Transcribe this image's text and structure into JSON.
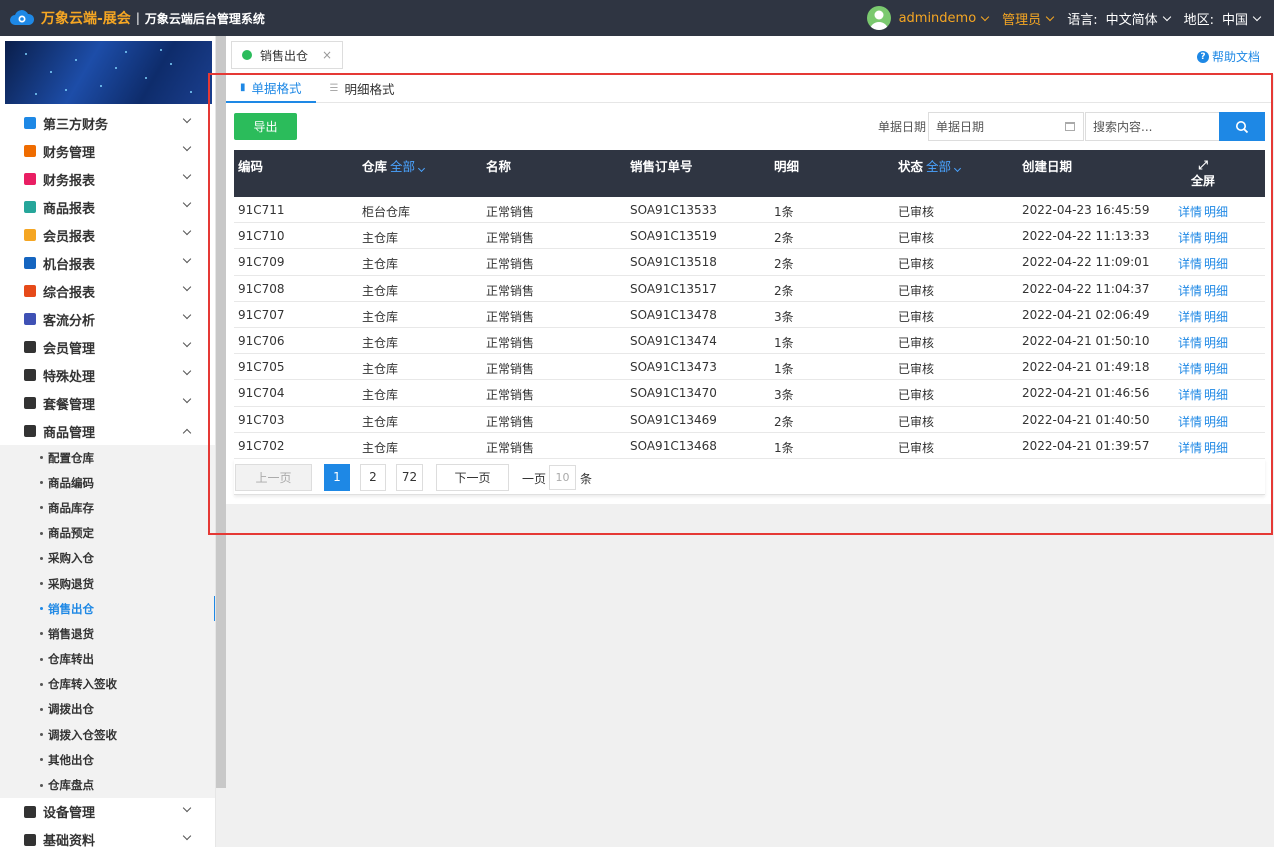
{
  "header": {
    "brand": "万象云端-展会",
    "separator": "|",
    "subtitle": "万象云端后台管理系统",
    "username": "admindemo",
    "role": "管理员",
    "language_label": "语言:",
    "language_value": "中文简体",
    "region_label": "地区:",
    "region_value": "中国"
  },
  "sidebar": {
    "menu_top": [
      {
        "label": "第三方财务",
        "icon_color": "#1e88e5"
      },
      {
        "label": "财务管理",
        "icon_color": "#ef6c00"
      },
      {
        "label": "财务报表",
        "icon_color": "#e91e63"
      },
      {
        "label": "商品报表",
        "icon_color": "#26a69a"
      },
      {
        "label": "会员报表",
        "icon_color": "#f5a623"
      },
      {
        "label": "机台报表",
        "icon_color": "#1565c0"
      },
      {
        "label": "综合报表",
        "icon_color": "#e64a19"
      },
      {
        "label": "客流分析",
        "icon_color": "#3f51b5"
      },
      {
        "label": "会员管理",
        "icon_color": "#333333"
      },
      {
        "label": "特殊处理",
        "icon_color": "#333333"
      },
      {
        "label": "套餐管理",
        "icon_color": "#333333"
      },
      {
        "label": "商品管理",
        "icon_color": "#333333"
      }
    ],
    "submenu": [
      "配置仓库",
      "商品编码",
      "商品库存",
      "商品预定",
      "采购入仓",
      "采购退货",
      "销售出仓",
      "销售退货",
      "仓库转出",
      "仓库转入签收",
      "调拨出仓",
      "调拨入仓签收",
      "其他出仓",
      "仓库盘点"
    ],
    "menu_bottom": [
      {
        "label": "设备管理",
        "icon_color": "#333333"
      },
      {
        "label": "基础资料",
        "icon_color": "#333333"
      }
    ]
  },
  "tabs": {
    "page_tab": "销售出仓",
    "close": "×",
    "help": "帮助文档",
    "help_icon": "?"
  },
  "subtabs": {
    "doc_format": "单据格式",
    "detail_format": "明细格式"
  },
  "toolbar": {
    "export": "导出",
    "date_label": "单据日期",
    "date_placeholder": "单据日期",
    "search_placeholder": "搜索内容..."
  },
  "table": {
    "headers": {
      "code": "编码",
      "warehouse": "仓库",
      "warehouse_filter": "全部",
      "name": "名称",
      "order_no": "销售订单号",
      "detail": "明细",
      "status": "状态",
      "status_filter": "全部",
      "created": "创建日期",
      "fullscreen": "全屏"
    },
    "rows": [
      {
        "code": "91C711",
        "warehouse": "柜台仓库",
        "name": "正常销售",
        "order_no": "SOA91C13533",
        "detail": "1条",
        "status": "已审核",
        "created": "2022-04-23 16:45:59",
        "action1": "详情",
        "action2": "明细"
      },
      {
        "code": "91C710",
        "warehouse": "主仓库",
        "name": "正常销售",
        "order_no": "SOA91C13519",
        "detail": "2条",
        "status": "已审核",
        "created": "2022-04-22 11:13:33",
        "action1": "详情",
        "action2": "明细"
      },
      {
        "code": "91C709",
        "warehouse": "主仓库",
        "name": "正常销售",
        "order_no": "SOA91C13518",
        "detail": "2条",
        "status": "已审核",
        "created": "2022-04-22 11:09:01",
        "action1": "详情",
        "action2": "明细"
      },
      {
        "code": "91C708",
        "warehouse": "主仓库",
        "name": "正常销售",
        "order_no": "SOA91C13517",
        "detail": "2条",
        "status": "已审核",
        "created": "2022-04-22 11:04:37",
        "action1": "详情",
        "action2": "明细"
      },
      {
        "code": "91C707",
        "warehouse": "主仓库",
        "name": "正常销售",
        "order_no": "SOA91C13478",
        "detail": "3条",
        "status": "已审核",
        "created": "2022-04-21 02:06:49",
        "action1": "详情",
        "action2": "明细"
      },
      {
        "code": "91C706",
        "warehouse": "主仓库",
        "name": "正常销售",
        "order_no": "SOA91C13474",
        "detail": "1条",
        "status": "已审核",
        "created": "2022-04-21 01:50:10",
        "action1": "详情",
        "action2": "明细"
      },
      {
        "code": "91C705",
        "warehouse": "主仓库",
        "name": "正常销售",
        "order_no": "SOA91C13473",
        "detail": "1条",
        "status": "已审核",
        "created": "2022-04-21 01:49:18",
        "action1": "详情",
        "action2": "明细"
      },
      {
        "code": "91C704",
        "warehouse": "主仓库",
        "name": "正常销售",
        "order_no": "SOA91C13470",
        "detail": "3条",
        "status": "已审核",
        "created": "2022-04-21 01:46:56",
        "action1": "详情",
        "action2": "明细"
      },
      {
        "code": "91C703",
        "warehouse": "主仓库",
        "name": "正常销售",
        "order_no": "SOA91C13469",
        "detail": "2条",
        "status": "已审核",
        "created": "2022-04-21 01:40:50",
        "action1": "详情",
        "action2": "明细"
      },
      {
        "code": "91C702",
        "warehouse": "主仓库",
        "name": "正常销售",
        "order_no": "SOA91C13468",
        "detail": "1条",
        "status": "已审核",
        "created": "2022-04-21 01:39:57",
        "action1": "详情",
        "action2": "明细"
      }
    ]
  },
  "pagination": {
    "prev": "上一页",
    "page1": "1",
    "page2": "2",
    "page_last": "72",
    "next": "下一页",
    "per_page_prefix": "一页",
    "per_page_value": "10",
    "per_page_suffix": "条"
  },
  "colors": {
    "accent": "#1e88e5",
    "export_green": "#2bbc5b",
    "brand_orange": "#f5a623",
    "header_dark": "#2f3542",
    "highlight_red": "#e53935"
  }
}
